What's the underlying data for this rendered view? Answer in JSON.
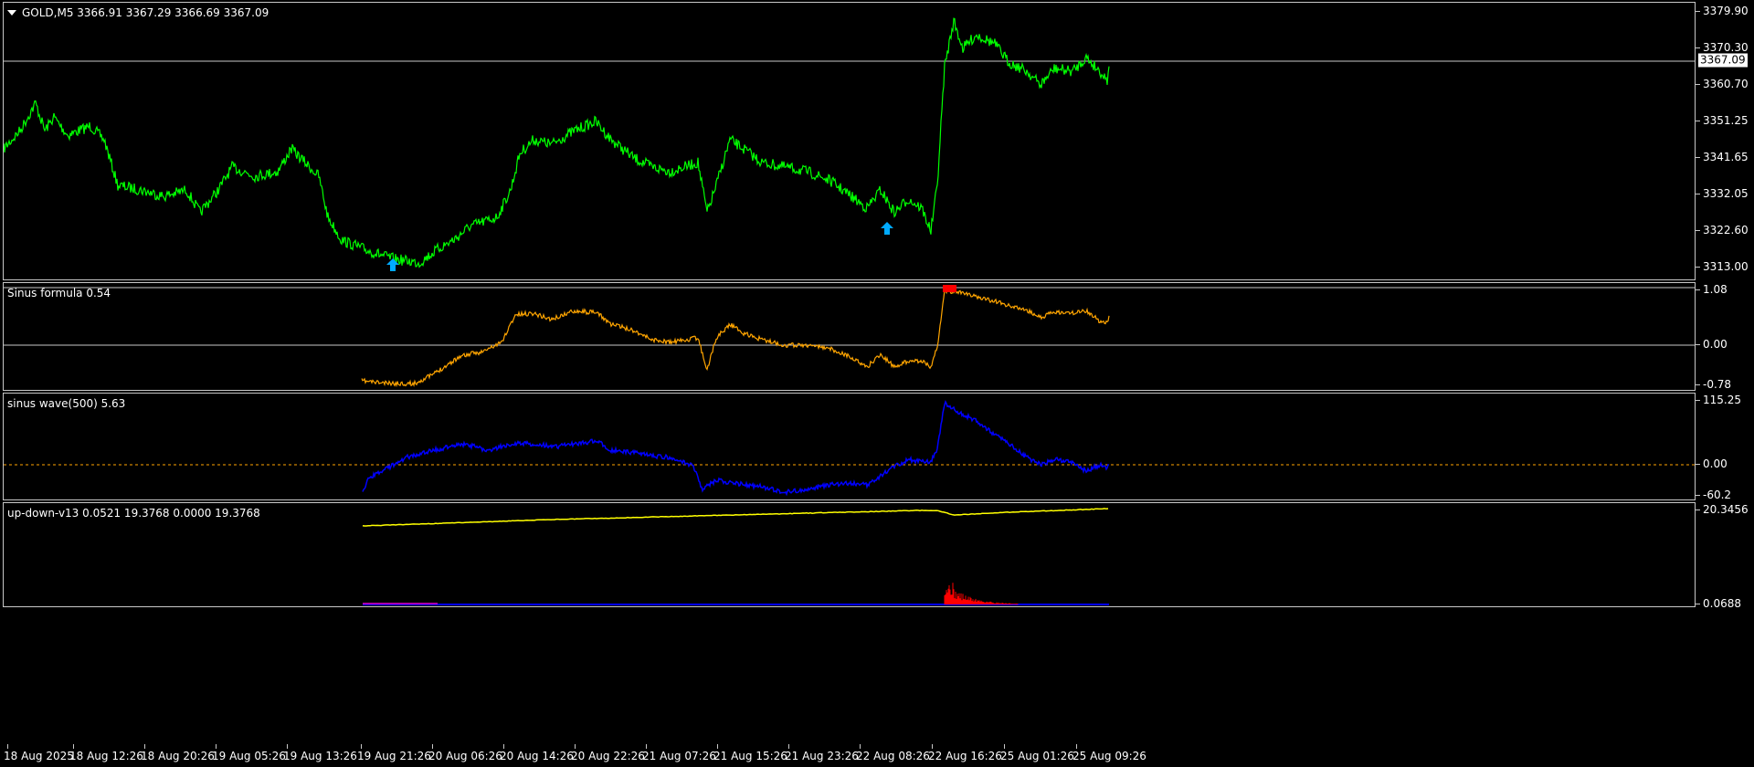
{
  "main_chart": {
    "symbol_title": "GOLD,M5  3366.91 3367.29 3366.69 3367.09",
    "price_labels": [
      "3379.90",
      "3370.30",
      "3360.70",
      "3351.25",
      "3341.65",
      "3332.05",
      "3322.60",
      "3313.00"
    ],
    "current_price": "3367.09",
    "line_color": "#00ff00",
    "arrow_color": "#00aaff"
  },
  "indicators": [
    {
      "title": "Sinus formula 0.54",
      "labels": [
        "1.08",
        "0.00",
        "-0.78"
      ],
      "color": "#ffa500"
    },
    {
      "title": "sinus wave(500) 5.63",
      "labels": [
        "115.25",
        "0.00",
        "-60.2"
      ],
      "color": "#0000ff"
    },
    {
      "title": "up-down-v13 0.0521 19.3768 0.0000 19.3768",
      "labels": [
        "20.3456",
        "0.0688"
      ],
      "color": "#ffff00"
    }
  ],
  "time_axis": [
    "18 Aug 2025",
    "18 Aug 12:26",
    "18 Aug 20:26",
    "19 Aug 05:26",
    "19 Aug 13:26",
    "19 Aug 21:26",
    "20 Aug 06:26",
    "20 Aug 14:26",
    "20 Aug 22:26",
    "21 Aug 07:26",
    "21 Aug 15:26",
    "21 Aug 23:26",
    "22 Aug 08:26",
    "22 Aug 16:26",
    "25 Aug 01:26",
    "25 Aug 09:26"
  ]
}
